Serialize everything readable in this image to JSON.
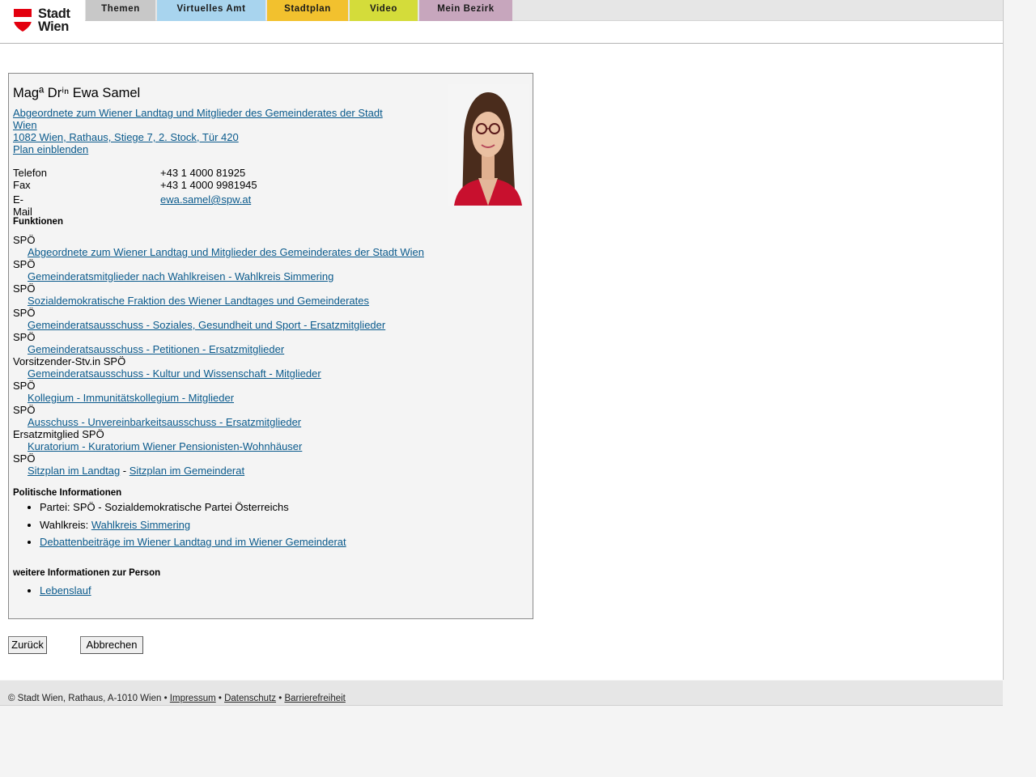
{
  "header": {
    "logo_line1": "Stadt",
    "logo_line2": "Wien",
    "tabs": [
      {
        "label": "Themen",
        "color": "#c8c8c8"
      },
      {
        "label": "Virtuelles Amt",
        "color": "#a8d4ee"
      },
      {
        "label": "Stadtplan",
        "color": "#f2c12e"
      },
      {
        "label": "Video",
        "color": "#d4dc3a"
      },
      {
        "label": "Mein Bezirk",
        "color": "#c7a6bd"
      }
    ]
  },
  "person": {
    "name": "Magª Drⁱⁿ Ewa Samel",
    "position_line1": "Abgeordnete zum Wiener Landtag und Mitglieder des Gemeinderates der Stadt",
    "position_line2": "Wien ",
    "address": "1082 Wien, Rathaus, Stiege 7, 2. Stock, Tür 420",
    "plan_link": "Plan einblenden",
    "contact": [
      {
        "label": "Telefon",
        "value": "+43 1 4000 81925"
      },
      {
        "label": "Fax",
        "value": "+43 1 4000 9981945"
      },
      {
        "label": "E-Mail",
        "value": "ewa.samel@spw.at"
      }
    ]
  },
  "functions": {
    "title": "Funktionen",
    "items": [
      {
        "role": "SPÖ",
        "link": "Abgeordnete zum Wiener Landtag und Mitglieder des Gemeinderates der Stadt Wien"
      },
      {
        "role": "SPÖ",
        "link": "Gemeinderatsmitglieder nach Wahlkreisen - Wahlkreis Simmering"
      },
      {
        "role": "SPÖ",
        "link": "Sozialdemokratische Fraktion des Wiener Landtages und Gemeinderates"
      },
      {
        "role": "SPÖ",
        "link": "Gemeinderatsausschuss - Soziales, Gesundheit und Sport - Ersatzmitglieder"
      },
      {
        "role": "SPÖ",
        "link": "Gemeinderatsausschuss - Petitionen - Ersatzmitglieder"
      },
      {
        "role": "Vorsitzender-Stv.in SPÖ",
        "link": "Gemeinderatsausschuss - Kultur und Wissenschaft - Mitglieder"
      },
      {
        "role": "SPÖ",
        "link": "Kollegium - Immunitätskollegium - Mitglieder"
      },
      {
        "role": "SPÖ",
        "link": "Ausschuss - Unvereinbarkeitsausschuss - Ersatzmitglieder"
      },
      {
        "role": "Ersatzmitglied SPÖ",
        "link": "Kuratorium - Kuratorium Wiener Pensionisten-Wohnhäuser"
      }
    ],
    "last_role": "SPÖ",
    "sitzplan_landtag": "Sitzplan im Landtag",
    "sitzplan_sep": " - ",
    "sitzplan_gemeinderat": "Sitzplan im Gemeinderat"
  },
  "political": {
    "title": "Politische Informationen",
    "party": "Partei: SPÖ - Sozialdemokratische Partei Österreichs",
    "wahlkreis_label": "Wahlkreis: ",
    "wahlkreis_link": "Wahlkreis Simmering",
    "debate_link": "Debattenbeiträge im Wiener Landtag und im Wiener Gemeinderat"
  },
  "further": {
    "title": "weitere Informationen zur Person",
    "cv_link": "Lebenslauf"
  },
  "buttons": {
    "back": "Zurück",
    "cancel": "Abbrechen"
  },
  "footer": {
    "copyright": "© Stadt Wien, Rathaus, A-1010 Wien",
    "sep": " • ",
    "impressum": "Impressum",
    "datenschutz": "Datenschutz",
    "barrierefreiheit": "Barrierefreiheit"
  }
}
